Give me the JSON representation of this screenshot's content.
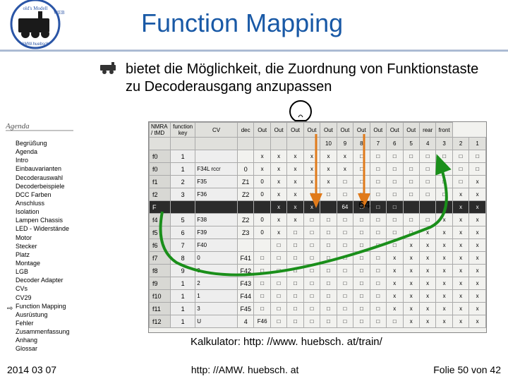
{
  "header": {
    "title": "Function Mapping"
  },
  "bullet": {
    "text": "bietet die Möglichkeit, die Zuordnung von Funktionstaste zu Decoderausgang anzupassen"
  },
  "sidebar": {
    "items": [
      "Begrüßung",
      "Agenda",
      "Intro",
      "Einbauvarianten",
      "Decoderauswahl",
      "Decoderbeispiele",
      "DCC Farben",
      "Anschluss",
      "Isolation",
      "Lampen Chassis",
      "LED - Widerstände",
      "Motor",
      "Stecker",
      "Platz",
      "Montage",
      "LGB",
      "Decoder Adapter",
      "CVs",
      "CV29",
      "Function Mapping",
      "Ausrüstung",
      "Fehler",
      "Zusammenfassung",
      "Anhang",
      "  Glossar"
    ],
    "currentIndex": 19,
    "arrow": "⇨"
  },
  "cv_table": {
    "headers": [
      "NMRA / tMD",
      "function key CV",
      "",
      "dec",
      "Out",
      "Out",
      "Out",
      "Out",
      "Out",
      "Out",
      "Out",
      "Out",
      "Out",
      "Out",
      "rear front",
      "",
      ""
    ],
    "subheaders": [
      "",
      "",
      "",
      "",
      "",
      "",
      "",
      "",
      "10",
      "9",
      "8",
      "7",
      "6",
      "5",
      "4",
      "3",
      "2",
      "1"
    ],
    "rows": [
      {
        "label": "f0",
        "cv": "1",
        "desc": "",
        "dec": "",
        "cells": [
          "x",
          "x",
          "x",
          "x",
          "x",
          "x",
          "□",
          "□",
          "□",
          "□",
          "□",
          "□",
          "□",
          "□"
        ]
      },
      {
        "label": "f0",
        "cv": "1",
        "desc": "F34L rccr",
        "dec": "0",
        "cells": [
          "x",
          "x",
          "x",
          "x",
          "x",
          "x",
          "□",
          "□",
          "□",
          "□",
          "□",
          "□",
          "□",
          "□"
        ]
      },
      {
        "label": "f1",
        "cv": "2",
        "desc": "F35",
        "dec": "Z1",
        "cells": [
          "0",
          "x",
          "x",
          "x",
          "x",
          "□",
          "□",
          "□",
          "□",
          "□",
          "□",
          "□",
          "□",
          "x"
        ]
      },
      {
        "label": "f2",
        "cv": "3",
        "desc": "F36",
        "dec": "Z2",
        "cells": [
          "0",
          "x",
          "x",
          "x",
          "□",
          "□",
          "□",
          "□",
          "□",
          "□",
          "□",
          "□",
          "x",
          "x"
        ]
      },
      {
        "label": "F",
        "cv": "",
        "hl": true,
        "desc": "",
        "dec": "",
        "cells": [
          "",
          "x",
          "x",
          "x",
          "",
          "64",
          "□",
          "□",
          "□",
          "",
          "",
          "",
          "x",
          "x"
        ]
      },
      {
        "label": "f4",
        "cv": "5",
        "desc": "F38",
        "dec": "Z2",
        "cells": [
          "0",
          "x",
          "x",
          "□",
          "□",
          "□",
          "□",
          "□",
          "□",
          "□",
          "□",
          "x",
          "x",
          "x"
        ]
      },
      {
        "label": "f5",
        "cv": "6",
        "desc": "F39",
        "dec": "Z3",
        "cells": [
          "0",
          "x",
          "□",
          "□",
          "□",
          "□",
          "□",
          "□",
          "□",
          "□",
          "x",
          "x",
          "x",
          "x"
        ]
      },
      {
        "label": "f6",
        "cv": "7",
        "desc": "F40",
        "dec": "",
        "cells": [
          "",
          "□",
          "□",
          "□",
          "□",
          "□",
          "□",
          "□",
          "□",
          "x",
          "x",
          "x",
          "x",
          "x"
        ]
      },
      {
        "label": "f7",
        "cv": "8",
        "desc": "0",
        "dec": "F41",
        "cells": [
          "□",
          "□",
          "□",
          "□",
          "□",
          "□",
          "□",
          "□",
          "x",
          "x",
          "x",
          "x",
          "x",
          "x"
        ]
      },
      {
        "label": "f8",
        "cv": "9",
        "desc": "0",
        "dec": "F42",
        "cells": [
          "□",
          "□",
          "□",
          "□",
          "□",
          "□",
          "□",
          "□",
          "x",
          "x",
          "x",
          "x",
          "x",
          "x"
        ]
      },
      {
        "label": "f9",
        "cv": "1",
        "desc": "2",
        "dec": "F43",
        "cells": [
          "□",
          "□",
          "□",
          "□",
          "□",
          "□",
          "□",
          "□",
          "x",
          "x",
          "x",
          "x",
          "x",
          "x"
        ]
      },
      {
        "label": "f10",
        "cv": "1",
        "desc": "1",
        "dec": "F44",
        "cells": [
          "□",
          "□",
          "□",
          "□",
          "□",
          "□",
          "□",
          "□",
          "x",
          "x",
          "x",
          "x",
          "x",
          "x"
        ]
      },
      {
        "label": "f11",
        "cv": "1",
        "desc": "3",
        "dec": "F45",
        "cells": [
          "□",
          "□",
          "□",
          "□",
          "□",
          "□",
          "□",
          "□",
          "x",
          "x",
          "x",
          "x",
          "x",
          "x"
        ]
      },
      {
        "label": "f12",
        "cv": "1",
        "desc": "U",
        "dec": "4",
        "cells": [
          "F46",
          "□",
          "□",
          "□",
          "□",
          "□",
          "□",
          "□",
          "□",
          "x",
          "x",
          "x",
          "x",
          "x"
        ]
      }
    ]
  },
  "annotation": {
    "value64": "64"
  },
  "calc": {
    "text": "Kalkulator: http: //www. huebsch. at/train/"
  },
  "footer": {
    "left": "2014 03 07",
    "mid": "http: //AMW. huebsch. at",
    "right_prefix": "Folie ",
    "page": "50",
    "right_mid": " von ",
    "total": "42"
  }
}
